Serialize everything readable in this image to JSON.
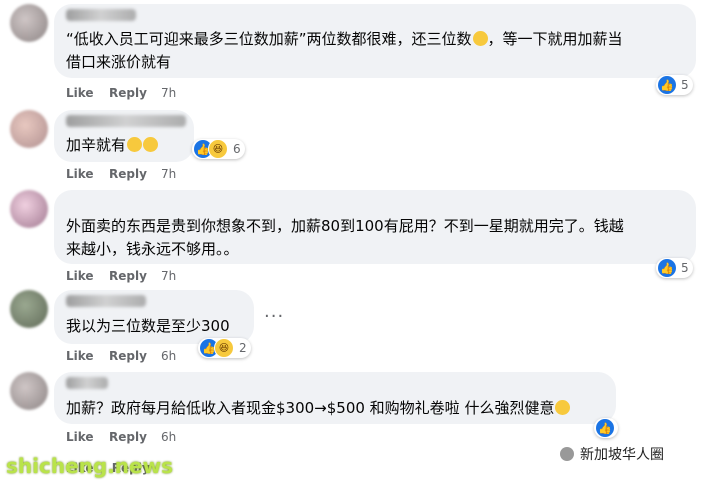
{
  "comments": [
    {
      "text_lines": [
        "“低收入员工可迎来最多三位数加薪”两位数都很难，还三位数",
        "借口来涨价就有"
      ],
      "text_continued": "，等一下就用加薪当",
      "emoji": [
        "laughing-crying"
      ],
      "actions": {
        "like": "Like",
        "reply": "Reply",
        "time": "7h"
      },
      "reactions": {
        "types": [
          "like"
        ],
        "count": "5"
      }
    },
    {
      "text_lines": [
        "加辛就有"
      ],
      "emoji": [
        "smile",
        "smile"
      ],
      "actions": {
        "like": "Like",
        "reply": "Reply",
        "time": "7h"
      },
      "reactions": {
        "types": [
          "like",
          "haha"
        ],
        "count": "6"
      }
    },
    {
      "text_lines": [
        "外面卖的东西是贵到你想象不到，加薪80到100有屁用？不到一星期就用完了。钱越",
        "来越小，钱永远不够用。。"
      ],
      "actions": {
        "like": "Like",
        "reply": "Reply",
        "time": "7h"
      },
      "reactions": {
        "types": [
          "like"
        ],
        "count": "5"
      }
    },
    {
      "text_lines": [
        "我以为三位数是至少300"
      ],
      "actions": {
        "like": "Like",
        "reply": "Reply",
        "time": "6h"
      },
      "reactions": {
        "types": [
          "like",
          "haha"
        ],
        "count": "2"
      },
      "more": "···"
    },
    {
      "text_lines": [
        "加薪？政府每月給低收入者现金$300→$500 和购物礼卷啦 什么強烈健意"
      ],
      "emoji": [
        "smirk"
      ],
      "actions": {
        "like": "Like",
        "reply": "Reply",
        "time": "6h"
      },
      "reactions": {
        "types": [
          "like"
        ],
        "count": ""
      }
    }
  ],
  "footer": {
    "watermark": "shicheng.news",
    "partial_actions": "Like Reply",
    "brand": "新加坡华人圈"
  },
  "colors": {
    "like_blue": "#1b74e4",
    "bubble": "#f0f2f5",
    "meta": "#65676b"
  }
}
